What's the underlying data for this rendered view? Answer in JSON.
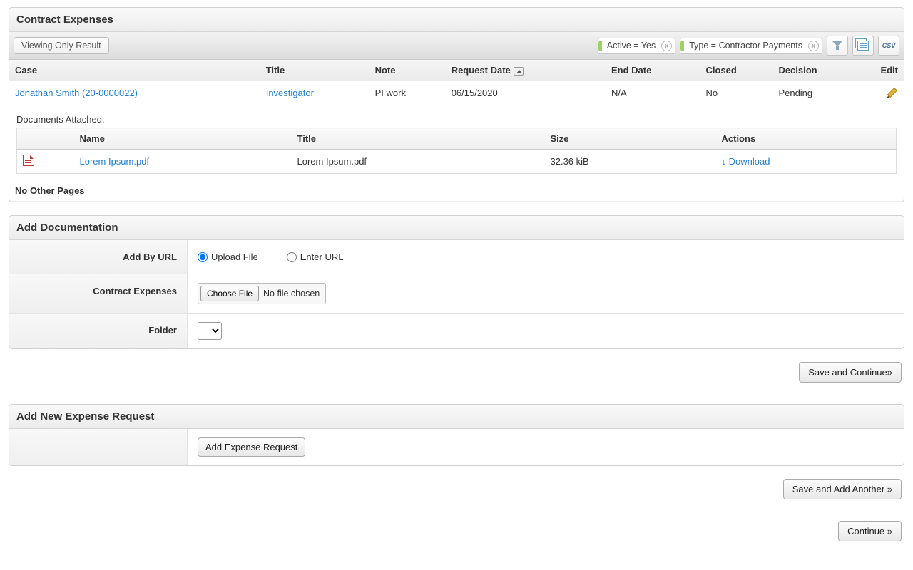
{
  "panel1": {
    "title": "Contract Expenses",
    "viewing_btn": "Viewing Only Result",
    "filters": [
      {
        "label": "Active = Yes"
      },
      {
        "label": "Type = Contractor Payments"
      }
    ],
    "columns": {
      "case": "Case",
      "title": "Title",
      "note": "Note",
      "request_date": "Request Date",
      "end_date": "End Date",
      "closed": "Closed",
      "decision": "Decision",
      "edit": "Edit"
    },
    "row": {
      "case": "Jonathan Smith (20-0000022)",
      "title": "Investigator",
      "note": "PI work",
      "request_date": "06/15/2020",
      "end_date": "N/A",
      "closed": "No",
      "decision": "Pending"
    },
    "documents": {
      "heading": "Documents Attached:",
      "columns": {
        "name": "Name",
        "title": "Title",
        "size": "Size",
        "actions": "Actions"
      },
      "row": {
        "name": "Lorem Ipsum.pdf",
        "title": "Lorem Ipsum.pdf",
        "size": "32.36 kiB",
        "download": "↓ Download"
      }
    },
    "pager": "No Other Pages"
  },
  "panel2": {
    "title": "Add Documentation",
    "labels": {
      "add_by_url": "Add By URL",
      "upload_file": "Upload File",
      "enter_url": "Enter URL",
      "contract_expenses": "Contract Expenses",
      "choose_file": "Choose File",
      "no_file": "No file chosen",
      "folder": "Folder"
    },
    "save_continue": "Save and Continue»"
  },
  "panel3": {
    "title": "Add New Expense Request",
    "add_btn": "Add Expense Request",
    "save_add_another": "Save and Add Another »"
  },
  "continue_btn": "Continue »",
  "csv_label": "CSV"
}
